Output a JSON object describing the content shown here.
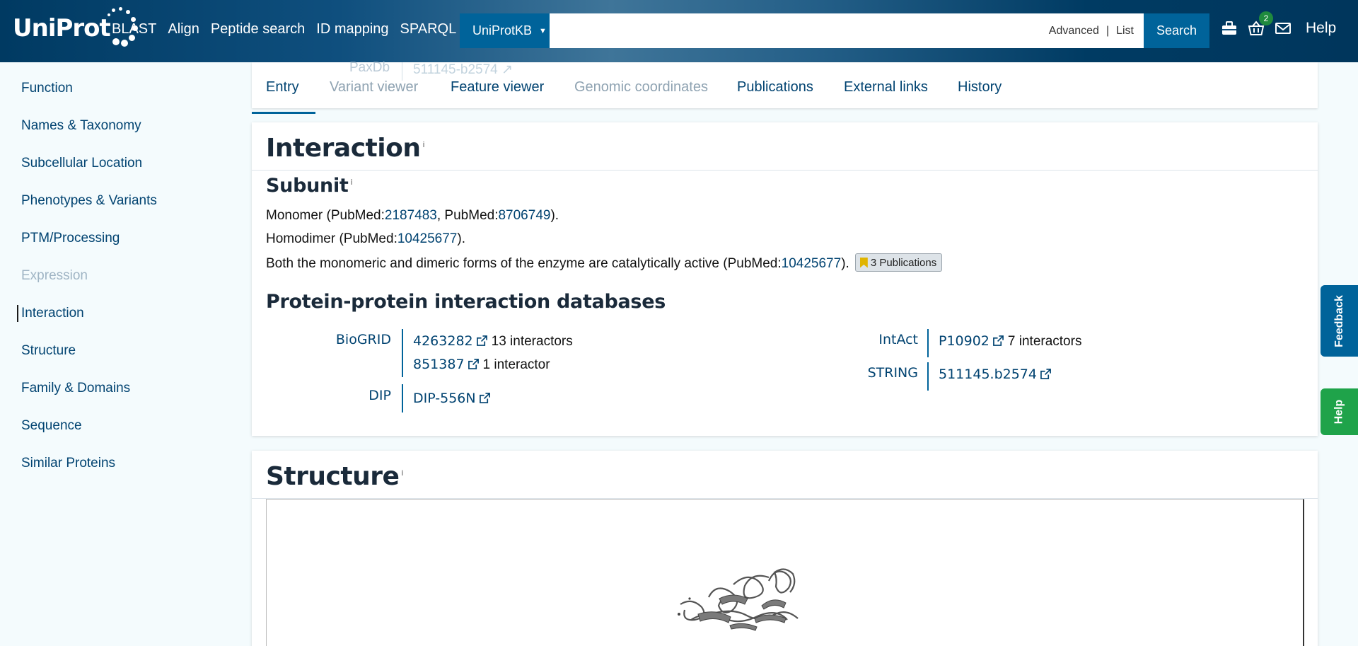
{
  "header": {
    "logo_text": "UniProt",
    "nav": [
      "BLAST",
      "Align",
      "Peptide search",
      "ID mapping",
      "SPARQL"
    ],
    "database_select": "UniProtKB",
    "search_value": "",
    "search_links": {
      "advanced": "Advanced",
      "separator": "|",
      "list": "List"
    },
    "search_button": "Search",
    "basket_count": "2",
    "help": "Help",
    "icons": [
      "tools-icon",
      "basket-icon",
      "mail-icon"
    ]
  },
  "sidebar": {
    "items": [
      {
        "label": "Function",
        "disabled": false
      },
      {
        "label": "Names & Taxonomy",
        "disabled": false
      },
      {
        "label": "Subcellular Location",
        "disabled": false
      },
      {
        "label": "Phenotypes & Variants",
        "disabled": false
      },
      {
        "label": "PTM/Processing",
        "disabled": false
      },
      {
        "label": "Expression",
        "disabled": true
      },
      {
        "label": "Interaction",
        "disabled": false,
        "active": true
      },
      {
        "label": "Structure",
        "disabled": false
      },
      {
        "label": "Family & Domains",
        "disabled": false
      },
      {
        "label": "Sequence",
        "disabled": false
      },
      {
        "label": "Similar Proteins",
        "disabled": false
      }
    ]
  },
  "behind_tabs": {
    "label": "PaxDb",
    "value": "511145-b2574"
  },
  "tabs": [
    {
      "label": "Entry",
      "active": true
    },
    {
      "label": "Variant viewer",
      "muted": true
    },
    {
      "label": "Feature viewer"
    },
    {
      "label": "Genomic coordinates",
      "muted": true
    },
    {
      "label": "Publications"
    },
    {
      "label": "External links"
    },
    {
      "label": "History"
    }
  ],
  "interaction": {
    "title": "Interaction",
    "info": "i",
    "subunit_title": "Subunit",
    "lines": {
      "l1": {
        "a": "Monomer (PubMed:",
        "p1": "2187483",
        "b": ", PubMed:",
        "p2": "8706749",
        "c": ")."
      },
      "l2": {
        "a": "Homodimer (PubMed:",
        "p1": "10425677",
        "c": ")."
      },
      "l3": {
        "a": "Both the monomeric and dimeric forms of the enzyme are catalytically active (PubMed:",
        "p1": "10425677",
        "c": ").",
        "pubs": "3 Publications"
      }
    },
    "ppi_title": "Protein-protein interaction databases",
    "databases": {
      "biogrid": {
        "label": "BioGRID",
        "rows": [
          {
            "id": "4263282",
            "note": "13 interactors"
          },
          {
            "id": "851387",
            "note": "1 interactor"
          }
        ]
      },
      "dip": {
        "label": "DIP",
        "rows": [
          {
            "id": "DIP-556N",
            "note": ""
          }
        ]
      },
      "intact": {
        "label": "IntAct",
        "rows": [
          {
            "id": "P10902",
            "note": "7 interactors"
          }
        ]
      },
      "string": {
        "label": "STRING",
        "rows": [
          {
            "id": "511145.b2574",
            "note": ""
          }
        ]
      }
    }
  },
  "structure": {
    "title": "Structure",
    "info": "i"
  },
  "floating": {
    "feedback": "Feedback",
    "help": "Help"
  },
  "colors": {
    "header_dark": "#003a62",
    "link": "#014371",
    "accent": "#00639a",
    "feedback": "#00639a",
    "help_tab": "#1fa34a"
  }
}
